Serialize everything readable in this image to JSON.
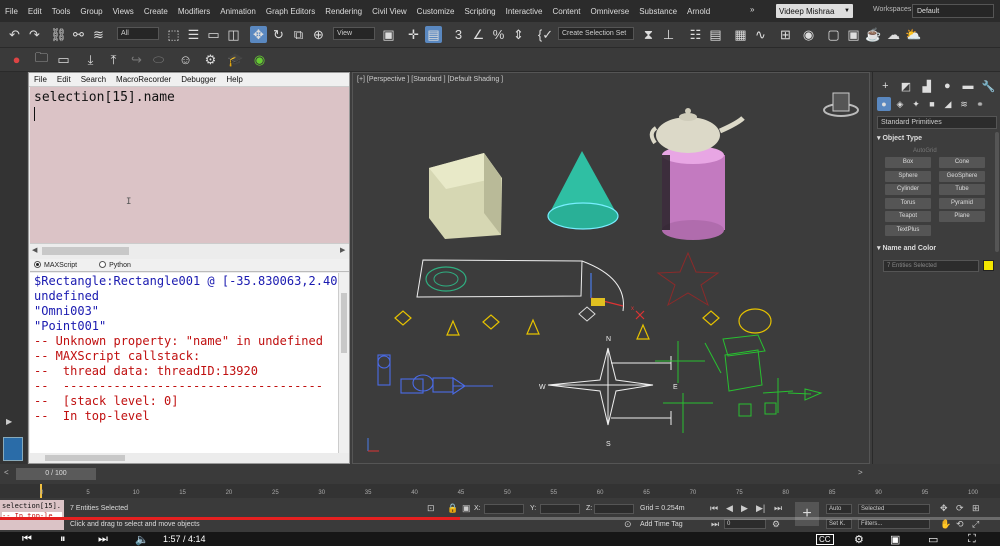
{
  "menubar": {
    "items": [
      "File",
      "Edit",
      "Tools",
      "Group",
      "Views",
      "Create",
      "Modifiers",
      "Animation",
      "Graph Editors",
      "Rendering",
      "Civil View",
      "Customize",
      "Scripting",
      "Interactive",
      "Content",
      "Omniverse",
      "Substance",
      "Arnold"
    ],
    "more": "»",
    "user": "Videep Mishraa",
    "workspaces_label": "Workspaces:",
    "workspace_value": "Default"
  },
  "toolbar": {
    "filter_value": "All",
    "view_value": "View",
    "selection_set_value": "Create Selection Set"
  },
  "editor": {
    "menu": [
      "File",
      "Edit",
      "Search",
      "MacroRecorder",
      "Debugger",
      "Help"
    ],
    "code_line": "selection[15].name",
    "tabs": [
      "MAXScript",
      "Python"
    ],
    "listener_lines": [
      {
        "text": "$Rectangle:Rectangle001 @ [-35.830063,2.40",
        "color": "blue"
      },
      {
        "text": "undefined",
        "color": "blue"
      },
      {
        "text": "\"Omni003\"",
        "color": "blue"
      },
      {
        "text": "\"Point001\"",
        "color": "blue"
      },
      {
        "text": "-- Unknown property: \"name\" in undefined",
        "color": "red"
      },
      {
        "text": "-- MAXScript callstack:",
        "color": "red"
      },
      {
        "text": "--  thread data: threadID:13920",
        "color": "red"
      },
      {
        "text": "--  ------------------------------------",
        "color": "red"
      },
      {
        "text": "--  [stack level: 0]",
        "color": "red"
      },
      {
        "text": "--  In top-level",
        "color": "red"
      }
    ]
  },
  "viewport": {
    "label": "[+] [Perspective ] [Standard ] [Default Shading ]",
    "compass": {
      "n": "N",
      "s": "S",
      "e": "E",
      "w": "W"
    }
  },
  "command_panel": {
    "category_value": "Standard Primitives",
    "object_type_title": "Object Type",
    "autogrid": "AutoGrid",
    "buttons": [
      "Box",
      "Cone",
      "Sphere",
      "GeoSphere",
      "Cylinder",
      "Tube",
      "Torus",
      "Pyramid",
      "Teapot",
      "Plane",
      "TextPlus"
    ],
    "name_color_title": "Name and Color",
    "name_value": "7 Entities Selected",
    "color": "#f2e600"
  },
  "timeslider": {
    "frame_label": "0 / 100",
    "left_arrow": "<",
    "right_arrow": ">",
    "ticks": [
      "0",
      "5",
      "10",
      "15",
      "20",
      "25",
      "30",
      "35",
      "40",
      "45",
      "50",
      "55",
      "60",
      "65",
      "70",
      "75",
      "80",
      "85",
      "90",
      "95",
      "100"
    ]
  },
  "statusbar": {
    "mini_listener_top": "selection[15].",
    "mini_listener_bottom": "-- In top-le",
    "selected_text": "7 Entities Selected",
    "prompt_text": "Click and drag to select and move objects",
    "x_label": "X:",
    "y_label": "Y:",
    "z_label": "Z:",
    "grid": "Grid = 0.254m",
    "add_time_tag": "Add Time Tag",
    "frame_value": "0",
    "auto_label": "Auto",
    "setk_label": "Set K.",
    "selected_dropdown": "Selected",
    "filters": "Filters..."
  },
  "player": {
    "time": "1:57 / 4:14",
    "progress_fraction": 0.46
  }
}
